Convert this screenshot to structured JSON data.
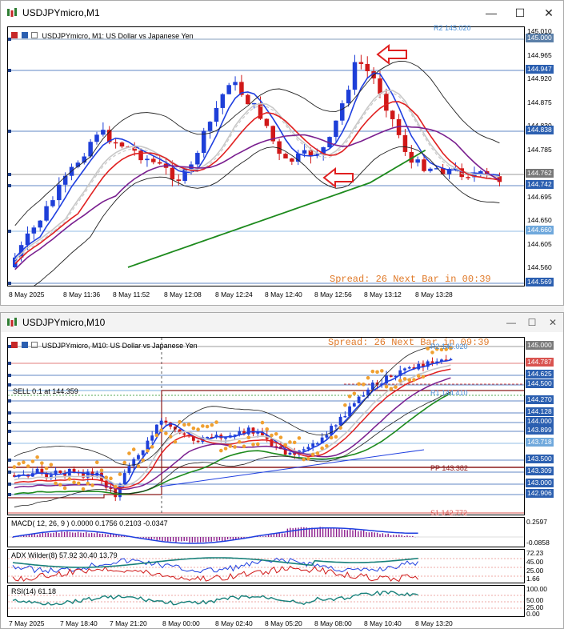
{
  "top_window": {
    "title": "USDJPYmicro,M1",
    "chart_info": "USDJPYmicro, M1:  US Dollar vs Japanese Yen",
    "spread_text": "Spread: 26  Next Bar in 00:39",
    "r2_label": "R2 145.020",
    "price_ticks": [
      "145.010",
      "144.965",
      "144.920",
      "144.875",
      "144.830",
      "144.785",
      "144.740",
      "144.695",
      "144.650",
      "144.605",
      "144.560"
    ],
    "price_tags": [
      {
        "text": "145.000",
        "color": "#5b7fa8"
      },
      {
        "text": "144.947",
        "color": "#2b5fb0"
      },
      {
        "text": "144.838",
        "color": "#2b5fb0"
      },
      {
        "text": "144.762",
        "color": "#777777"
      },
      {
        "text": "144.742",
        "color": "#2b5fb0"
      },
      {
        "text": "144.660",
        "color": "#6fa8dc"
      },
      {
        "text": "144.569",
        "color": "#2b5fb0"
      }
    ],
    "time_ticks": [
      "8 May 2025",
      "8 May 11:36",
      "8 May 11:52",
      "8 May 12:08",
      "8 May 12:24",
      "8 May 12:40",
      "8 May 12:56",
      "8 May 13:12",
      "8 May 13:28"
    ]
  },
  "bottom_window": {
    "title": "USDJPYmicro,M10",
    "chart_info": "USDJPYmicro, M10:  US Dollar vs Japanese Yen",
    "spread_text": "Spread: 26  Next Bar in 09:39",
    "r2_label": "R2 145.020",
    "r1_label": "R1 144.410",
    "pp_label": "PP 143.382",
    "s1_label": "S1 142.772",
    "sell_label": "SELL 0.1 at 144.359",
    "price_tags": [
      {
        "text": "145.000",
        "color": "#7a7a7a"
      },
      {
        "text": "144.787",
        "color": "#d9534f"
      },
      {
        "text": "144.625",
        "color": "#2b5fb0"
      },
      {
        "text": "144.500",
        "color": "#2b5fb0"
      },
      {
        "text": "144.270",
        "color": "#2b5fb0"
      },
      {
        "text": "144.128",
        "color": "#2b5fb0"
      },
      {
        "text": "144.000",
        "color": "#2b5fb0"
      },
      {
        "text": "143.899",
        "color": "#2b5fb0"
      },
      {
        "text": "143.718",
        "color": "#6fa8dc"
      },
      {
        "text": "143.500",
        "color": "#2b5fb0"
      },
      {
        "text": "143.309",
        "color": "#2b5fb0"
      },
      {
        "text": "143.000",
        "color": "#2b5fb0"
      },
      {
        "text": "142.906",
        "color": "#2b5fb0"
      }
    ],
    "macd_label": "MACD( 12, 26, 9 ) 0.0000 0.1756 0.2103 -0.0347",
    "macd_ticks": [
      "0.2597",
      "-0.0858"
    ],
    "adx_label": "ADX Wilder(8) 57.92 30.40 13.79",
    "adx_ticks": [
      "72.23",
      "45.00",
      "25.00",
      "1.66"
    ],
    "rsi_label": "RSI(14) 61.18",
    "rsi_ticks": [
      "100.00",
      "50.00",
      "25.00",
      "0.00"
    ],
    "time_ticks": [
      "7 May 2025",
      "7 May 18:40",
      "7 May 21:20",
      "8 May 00:00",
      "8 May 02:40",
      "8 May 05:20",
      "8 May 08:00",
      "8 May 10:40",
      "8 May 13:20"
    ]
  }
}
